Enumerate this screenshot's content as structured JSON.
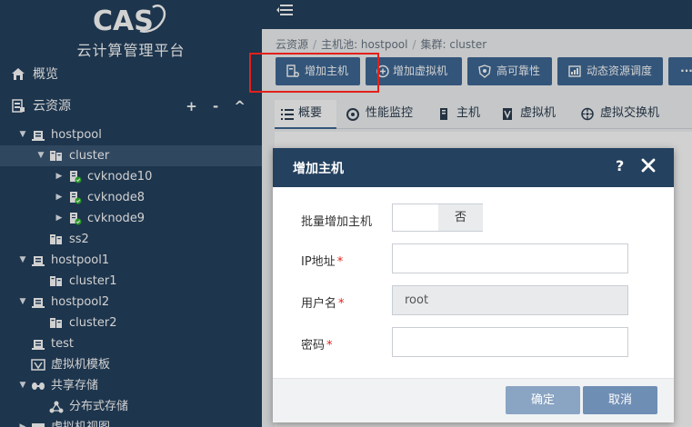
{
  "brand": {
    "logo_text": "CAS",
    "platform_title": "云计算管理平台"
  },
  "sidebar": {
    "overview_label": "概览",
    "cloud_resources_label": "云资源",
    "tree_controls": "+ - ^",
    "tree": [
      {
        "label": "hostpool",
        "caret": "▼",
        "icon": "host-pool-icon"
      },
      {
        "label": "cluster",
        "caret": "▼",
        "icon": "cluster-icon",
        "selected": true
      },
      {
        "label": "cvknode10",
        "caret": "▶",
        "icon": "host-node-icon"
      },
      {
        "label": "cvknode8",
        "caret": "▶",
        "icon": "host-node-icon"
      },
      {
        "label": "cvknode9",
        "caret": "▶",
        "icon": "host-node-icon"
      },
      {
        "label": "ss2",
        "caret": "",
        "icon": "cluster-icon"
      },
      {
        "label": "hostpool1",
        "caret": "▼",
        "icon": "host-pool-icon"
      },
      {
        "label": "cluster1",
        "caret": "",
        "icon": "cluster-icon"
      },
      {
        "label": "hostpool2",
        "caret": "▼",
        "icon": "host-pool-icon"
      },
      {
        "label": "cluster2",
        "caret": "",
        "icon": "cluster-icon"
      },
      {
        "label": "test",
        "caret": "",
        "icon": "host-pool-icon"
      },
      {
        "label": "虚拟机模板",
        "caret": "",
        "icon": "vm-template-icon"
      },
      {
        "label": "共享存储",
        "caret": "▼",
        "icon": "shared-storage-icon"
      },
      {
        "label": "分布式存储",
        "caret": "",
        "icon": "distributed-storage-icon"
      },
      {
        "label": "虚拟机视图",
        "caret": "▶",
        "icon": "vm-view-icon"
      }
    ]
  },
  "breadcrumb": {
    "root": "云资源",
    "sep": "/",
    "pool": "主机池: hostpool",
    "cluster": "集群: cluster"
  },
  "toolbar": {
    "add_host": "增加主机",
    "add_vm": "增加虚拟机",
    "ha": "高可靠性",
    "drs": "动态资源调度",
    "more": "···"
  },
  "tabs": {
    "overview": "概要",
    "perf": "性能监控",
    "host": "主机",
    "vm": "虚拟机",
    "vswitch": "虚拟交换机"
  },
  "dialog": {
    "title": "增加主机",
    "help": "?",
    "batch_label": "批量增加主机",
    "toggle_off": "否",
    "ip_label": "IP地址",
    "ip_value": "",
    "user_label": "用户名",
    "user_value": "root",
    "password_label": "密码",
    "password_value": "",
    "required_mark": "*",
    "confirm": "确定",
    "cancel": "取消"
  },
  "colors": {
    "sidebar_bg": "#24415f",
    "accent": "#3f6895",
    "highlight": "#e3201b"
  }
}
